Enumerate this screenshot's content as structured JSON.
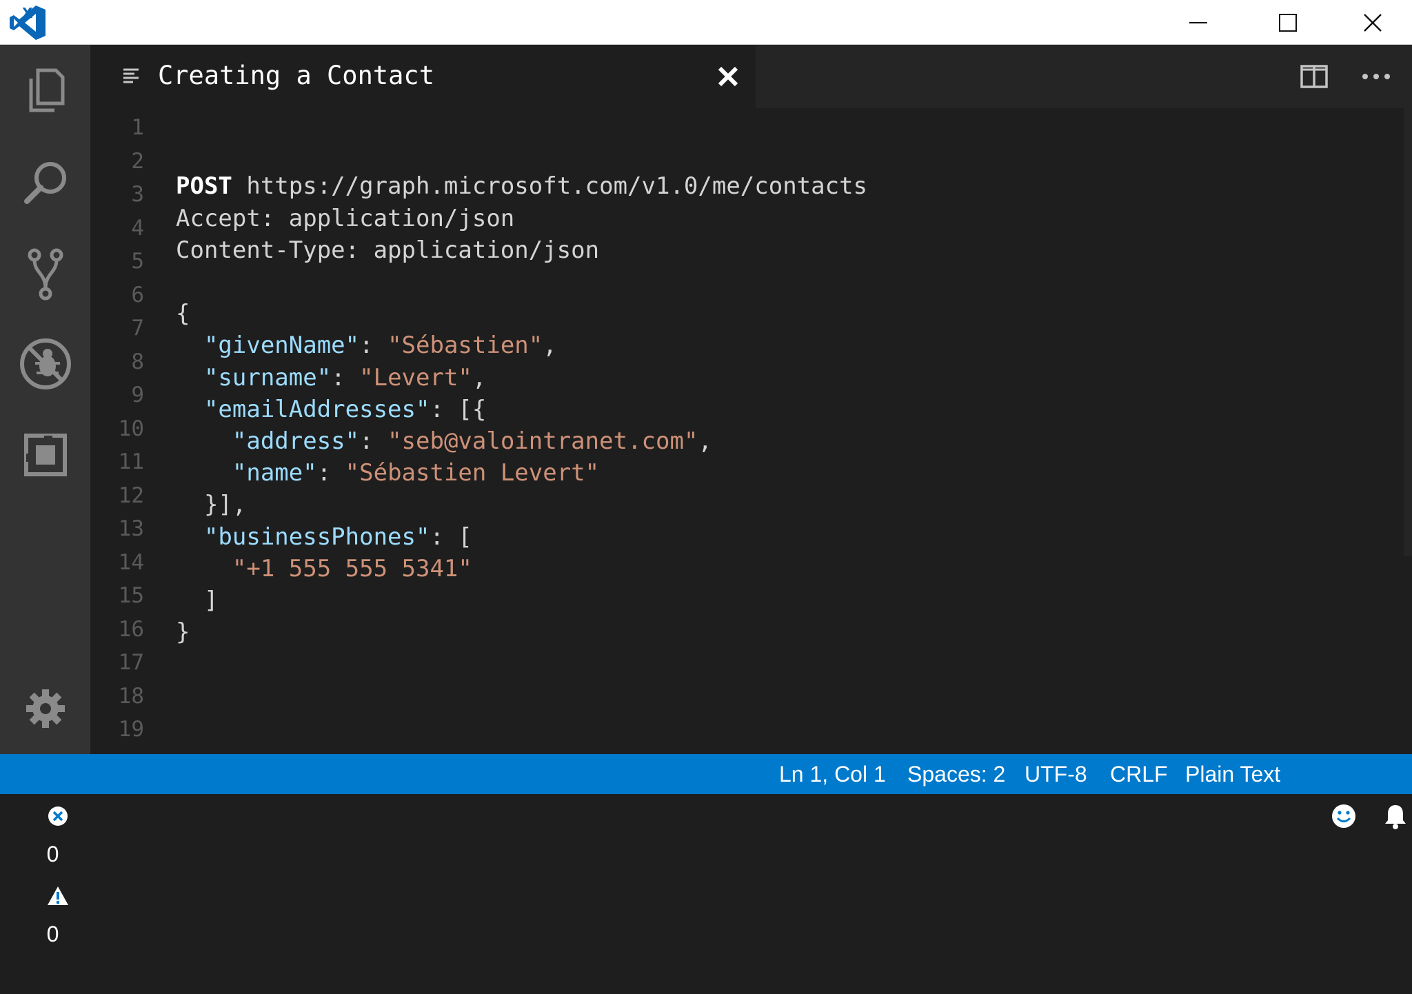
{
  "colors": {
    "accent": "#007acc",
    "editor_bg": "#1e1e1e",
    "activity_bg": "#333333",
    "keyword": "#ffffff",
    "json_key": "#9cdcfe",
    "json_string": "#ce9178"
  },
  "titlebar": {
    "icons": [
      "vscode-logo",
      "minimize-icon",
      "maximize-icon",
      "close-icon"
    ]
  },
  "activity": [
    "explorer-icon",
    "search-icon",
    "source-control-icon",
    "debug-icon",
    "extensions-icon",
    "settings-gear-icon"
  ],
  "tab": {
    "title": "Creating a Contact",
    "icon": "file-lines-icon"
  },
  "editor": {
    "line_numbers": [
      "1",
      "2",
      "3",
      "4",
      "5",
      "6",
      "7",
      "8",
      "9",
      "10",
      "11",
      "12",
      "13",
      "14",
      "15",
      "16",
      "17",
      "18",
      "19"
    ],
    "lines": [
      {
        "n": 3,
        "tokens": [
          {
            "t": "POST",
            "c": "k"
          },
          {
            "t": " https://graph.microsoft.com/v1.0/me/contacts",
            "c": ""
          }
        ]
      },
      {
        "n": 4,
        "tokens": [
          {
            "t": "Accept: application/json",
            "c": ""
          }
        ]
      },
      {
        "n": 5,
        "tokens": [
          {
            "t": "Content-Type: application/json",
            "c": ""
          }
        ]
      },
      {
        "n": 7,
        "tokens": [
          {
            "t": "{",
            "c": ""
          }
        ]
      },
      {
        "n": 8,
        "tokens": [
          {
            "t": "  ",
            "c": ""
          },
          {
            "t": "\"givenName\"",
            "c": "key"
          },
          {
            "t": ": ",
            "c": ""
          },
          {
            "t": "\"Sébastien\"",
            "c": "str"
          },
          {
            "t": ",",
            "c": ""
          }
        ]
      },
      {
        "n": 9,
        "tokens": [
          {
            "t": "  ",
            "c": ""
          },
          {
            "t": "\"surname\"",
            "c": "key"
          },
          {
            "t": ": ",
            "c": ""
          },
          {
            "t": "\"Levert\"",
            "c": "str"
          },
          {
            "t": ",",
            "c": ""
          }
        ]
      },
      {
        "n": 10,
        "tokens": [
          {
            "t": "  ",
            "c": ""
          },
          {
            "t": "\"emailAddresses\"",
            "c": "key"
          },
          {
            "t": ": [{",
            "c": ""
          }
        ]
      },
      {
        "n": 11,
        "tokens": [
          {
            "t": "    ",
            "c": ""
          },
          {
            "t": "\"address\"",
            "c": "key"
          },
          {
            "t": ": ",
            "c": ""
          },
          {
            "t": "\"seb@valointranet.com\"",
            "c": "str"
          },
          {
            "t": ",",
            "c": ""
          }
        ]
      },
      {
        "n": 12,
        "tokens": [
          {
            "t": "    ",
            "c": ""
          },
          {
            "t": "\"name\"",
            "c": "key"
          },
          {
            "t": ": ",
            "c": ""
          },
          {
            "t": "\"Sébastien Levert\"",
            "c": "str"
          }
        ]
      },
      {
        "n": 13,
        "tokens": [
          {
            "t": "  }],",
            "c": ""
          }
        ]
      },
      {
        "n": 14,
        "tokens": [
          {
            "t": "  ",
            "c": ""
          },
          {
            "t": "\"businessPhones\"",
            "c": "key"
          },
          {
            "t": ": [",
            "c": ""
          }
        ]
      },
      {
        "n": 15,
        "tokens": [
          {
            "t": "    ",
            "c": ""
          },
          {
            "t": "\"+1 555 555 5341\"",
            "c": "str"
          }
        ]
      },
      {
        "n": 16,
        "tokens": [
          {
            "t": "  ]",
            "c": ""
          }
        ]
      },
      {
        "n": 17,
        "tokens": [
          {
            "t": "}",
            "c": ""
          }
        ]
      }
    ]
  },
  "status": {
    "errors": "0",
    "warnings": "0",
    "position": "Ln 1, Col 1",
    "spaces": "Spaces: 2",
    "encoding": "UTF-8",
    "eol": "CRLF",
    "language": "Plain Text",
    "icons": [
      "error-icon",
      "warning-icon",
      "smiley-feedback-icon",
      "bell-icon"
    ]
  }
}
